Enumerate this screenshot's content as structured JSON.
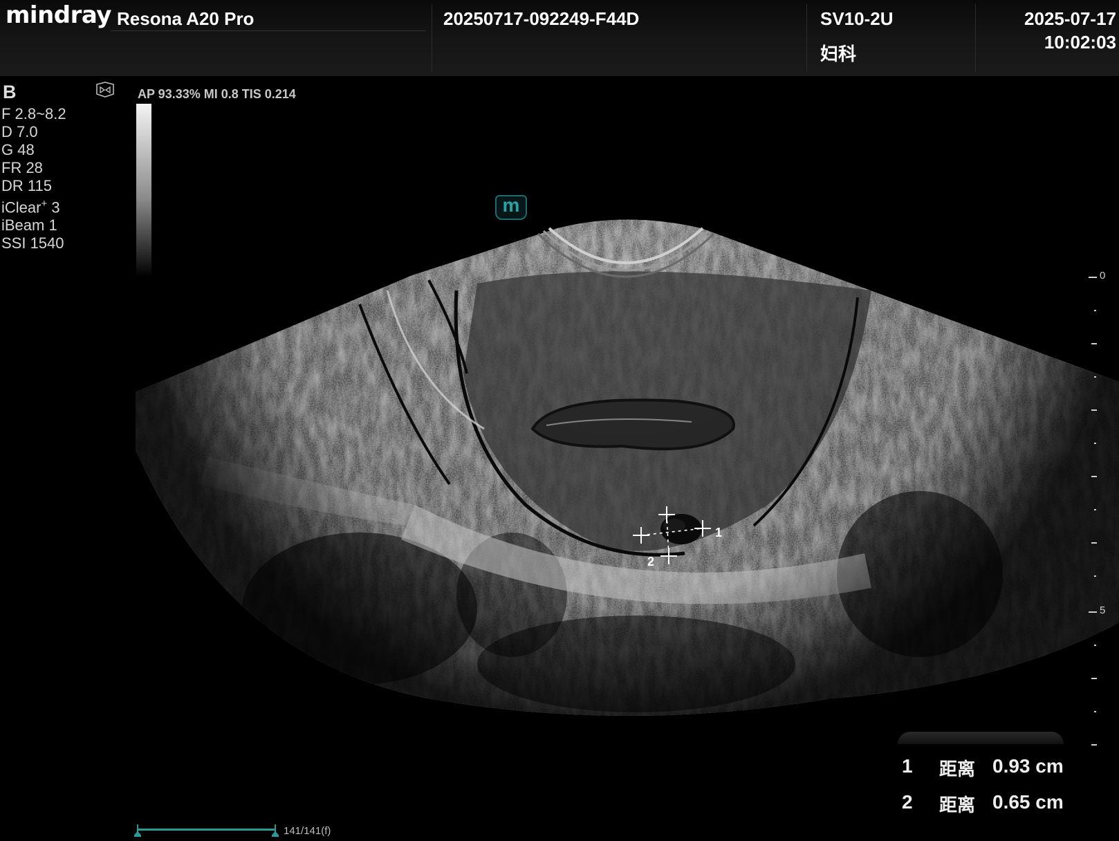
{
  "header": {
    "brand": "mindray",
    "model": "Resona A20 Pro",
    "exam_id": "20250717-092249-F44D",
    "probe": "SV10-2U",
    "department": "妇科",
    "date": "2025-07-17",
    "time": "10:02:03"
  },
  "imaging": {
    "mode": "B",
    "acoustic_output": "AP 93.33%   MI 0.8 TIS 0.214",
    "params": [
      {
        "label": "F 2.8~8.2"
      },
      {
        "label": "D 7.0"
      },
      {
        "label": "G 48"
      },
      {
        "label": "FR 28"
      },
      {
        "label": "DR 115"
      },
      {
        "label": "iClear",
        "sup": "+",
        "suffix": " 3"
      },
      {
        "label": "iBeam 1"
      },
      {
        "label": "SSI 1540"
      }
    ],
    "orientation_icon": "orientation-marker-icon",
    "mindray_marker": "m"
  },
  "depth_scale": {
    "labels": [
      {
        "text": "0",
        "value": 0
      },
      {
        "text": "5",
        "value": 5
      }
    ],
    "max_depth_cm": 7
  },
  "calipers": {
    "label_1": "1",
    "label_2": "2"
  },
  "measurements": [
    {
      "index": "1",
      "name": "距离",
      "value": "0.93 cm"
    },
    {
      "index": "2",
      "name": "距离",
      "value": "0.65 cm"
    }
  ],
  "cine": {
    "frames": "141/141(f)",
    "current": 141,
    "total": 141
  },
  "colors": {
    "accent_teal": "#2a9a98",
    "header_bg": "#161616"
  }
}
